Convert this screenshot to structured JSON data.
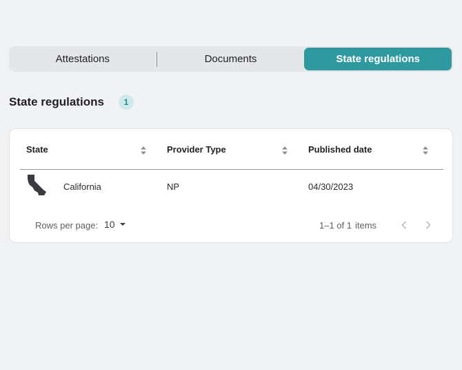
{
  "tabs": [
    {
      "label": "Attestations",
      "active": false
    },
    {
      "label": "Documents",
      "active": false
    },
    {
      "label": "State regulations",
      "active": true
    }
  ],
  "section": {
    "title": "State regulations",
    "count": "1"
  },
  "table": {
    "columns": [
      "State",
      "Provider Type",
      "Published date"
    ],
    "rows": [
      {
        "state": "California",
        "state_icon": "california-state-shape-icon",
        "provider_type": "NP",
        "published_date": "04/30/2023"
      }
    ]
  },
  "pagination": {
    "rows_per_page_label": "Rows per page:",
    "rows_per_page_value": "10",
    "range": "1–1 of 1",
    "items_label": "items"
  },
  "colors": {
    "accent": "#2e9aa0",
    "badge_bg": "#cfe9ea",
    "background": "#f1f2f4"
  }
}
